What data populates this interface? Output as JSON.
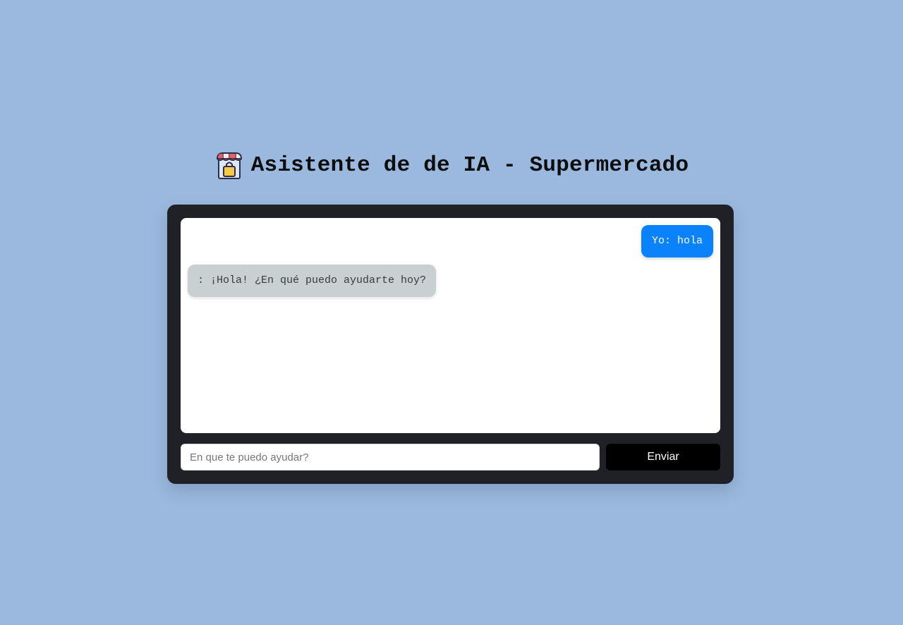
{
  "header": {
    "title": "Asistente de de IA - Supermercado",
    "logo_icon": "store-shopping-bag-icon"
  },
  "chat": {
    "messages": [
      {
        "sender": "user",
        "text": "Yo: hola"
      },
      {
        "sender": "assistant",
        "text": ": ¡Hola! ¿En qué puedo ayudarte hoy?"
      }
    ]
  },
  "composer": {
    "input_value": "",
    "input_placeholder": "En que te puedo ayudar?",
    "send_label": "Enviar"
  },
  "colors": {
    "page_background": "#9bb9de",
    "panel_background": "#202027",
    "user_bubble": "#0a82fb",
    "assistant_bubble": "#c8d0d2",
    "send_button": "#000000"
  }
}
